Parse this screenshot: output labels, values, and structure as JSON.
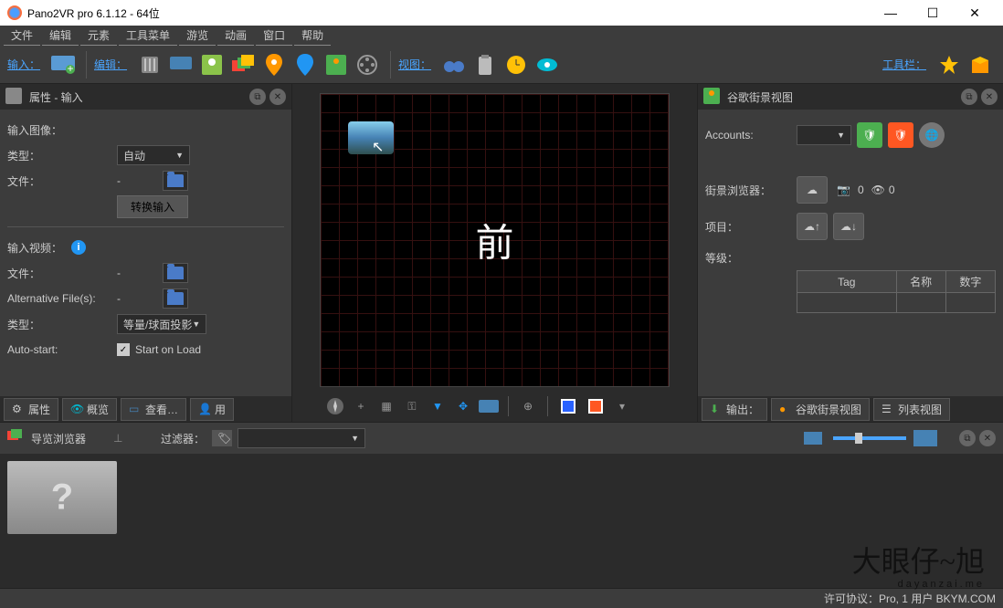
{
  "window": {
    "title": "Pano2VR pro 6.1.12 - 64位"
  },
  "menubar": [
    "文件",
    "编辑",
    "元素",
    "工具菜单",
    "游览",
    "动画",
    "窗口",
    "帮助"
  ],
  "toolbar": {
    "input_label": "输入：",
    "edit_label": "编辑：",
    "view_label": "视图：",
    "tools_label": "工具栏："
  },
  "left_panel": {
    "title": "属性 - 输入",
    "input_image_label": "输入图像：",
    "type_label": "类型：",
    "type_value": "自动",
    "file_label": "文件：",
    "file_value": "-",
    "convert_btn": "转换输入",
    "input_video_label": "输入视频：",
    "video_file_label": "文件：",
    "video_file_value": "-",
    "alt_files_label": "Alternative File(s):",
    "alt_files_value": "-",
    "video_type_label": "类型：",
    "video_type_value": "等量/球面投影",
    "autostart_label": "Auto-start:",
    "autostart_chk": "Start on Load",
    "tabs": {
      "props": "属性",
      "overview": "概览",
      "view": "查看…",
      "user": "用"
    }
  },
  "viewer": {
    "center_text": "前"
  },
  "right_panel": {
    "title": "谷歌街景视图",
    "accounts_label": "Accounts:",
    "browser_label": "街景浏览器：",
    "cam_count": "0",
    "eye_count": "0",
    "project_label": "项目：",
    "level_label": "等级：",
    "table": {
      "tag": "Tag",
      "name": "名称",
      "num": "数字"
    },
    "tabs": {
      "output": "输出：",
      "gsv": "谷歌街景视图",
      "list": "列表视图"
    }
  },
  "browser": {
    "title": "导览浏览器",
    "filter_label": "过滤器："
  },
  "status": {
    "license": "许可协议：Pro, 1 用户 BKYM.COM"
  },
  "watermark": {
    "main": "大眼仔~旭",
    "sub": "dayanzai.me"
  }
}
